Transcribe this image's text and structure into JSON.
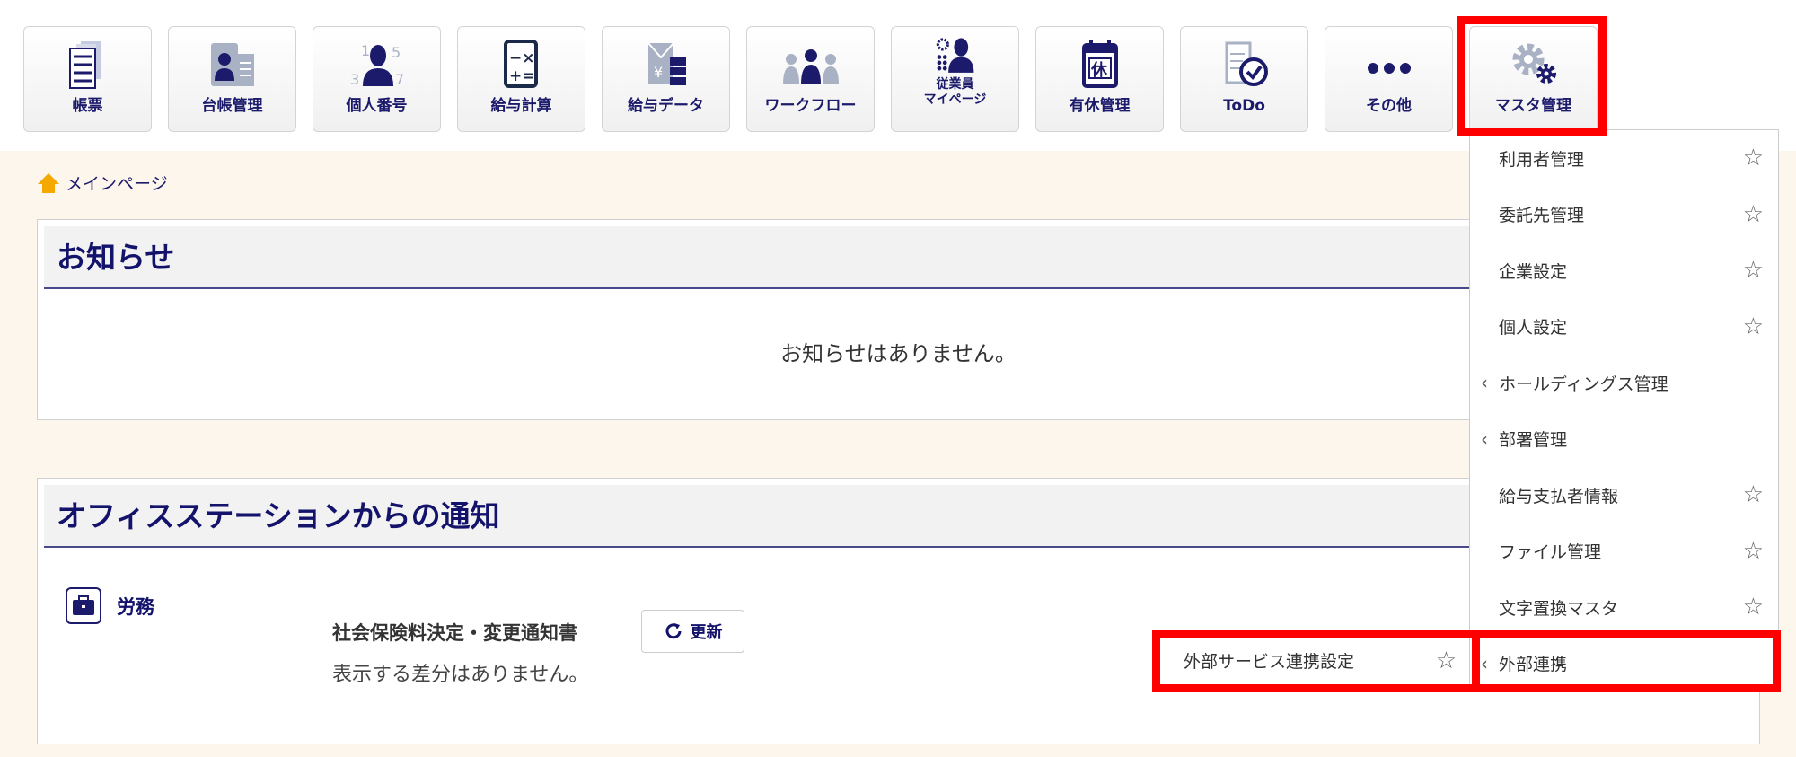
{
  "toolbar": {
    "items": [
      {
        "label": "帳票",
        "icon": "document-stack-icon"
      },
      {
        "label": "台帳管理",
        "icon": "id-card-icon"
      },
      {
        "label": "個人番号",
        "icon": "person-number-icon"
      },
      {
        "label": "給与計算",
        "icon": "calculator-icon"
      },
      {
        "label": "給与データ",
        "icon": "yen-data-icon"
      },
      {
        "label": "ワークフロー",
        "icon": "workflow-people-icon"
      },
      {
        "label": "従業員\nマイページ",
        "icon": "employee-gear-icon"
      },
      {
        "label": "有休管理",
        "icon": "calendar-holiday-icon",
        "glyph": "休"
      },
      {
        "label": "ToDo",
        "icon": "todo-check-icon"
      },
      {
        "label": "その他",
        "icon": "more-dots-icon"
      },
      {
        "label": "マスタ管理",
        "icon": "gears-icon"
      }
    ]
  },
  "breadcrumb": {
    "home": "メインページ"
  },
  "notices": {
    "title": "お知らせ",
    "empty": "お知らせはありません。"
  },
  "office": {
    "title": "オフィスステーションからの通知",
    "category": "労務",
    "doc_title": "社会保険料決定・変更通知書",
    "refresh": "更新",
    "no_diff": "表示する差分はありません。"
  },
  "menu": {
    "items": [
      {
        "label": "利用者管理",
        "star": true
      },
      {
        "label": "委託先管理",
        "star": true
      },
      {
        "label": "企業設定",
        "star": true
      },
      {
        "label": "個人設定",
        "star": true
      },
      {
        "label": "ホールディングス管理",
        "sub": true
      },
      {
        "label": "部署管理",
        "sub": true
      },
      {
        "label": "給与支払者情報",
        "star": true
      },
      {
        "label": "ファイル管理",
        "star": true
      },
      {
        "label": "文字置換マスタ",
        "star": true
      },
      {
        "label": "外部連携",
        "sub": true
      }
    ],
    "submenu": {
      "label": "外部サービス連携設定"
    }
  },
  "colors": {
    "navy": "#1b1a6b",
    "highlight": "#ff0000",
    "background": "#fdf6ec",
    "icon_gray": "#a9b1c4"
  }
}
